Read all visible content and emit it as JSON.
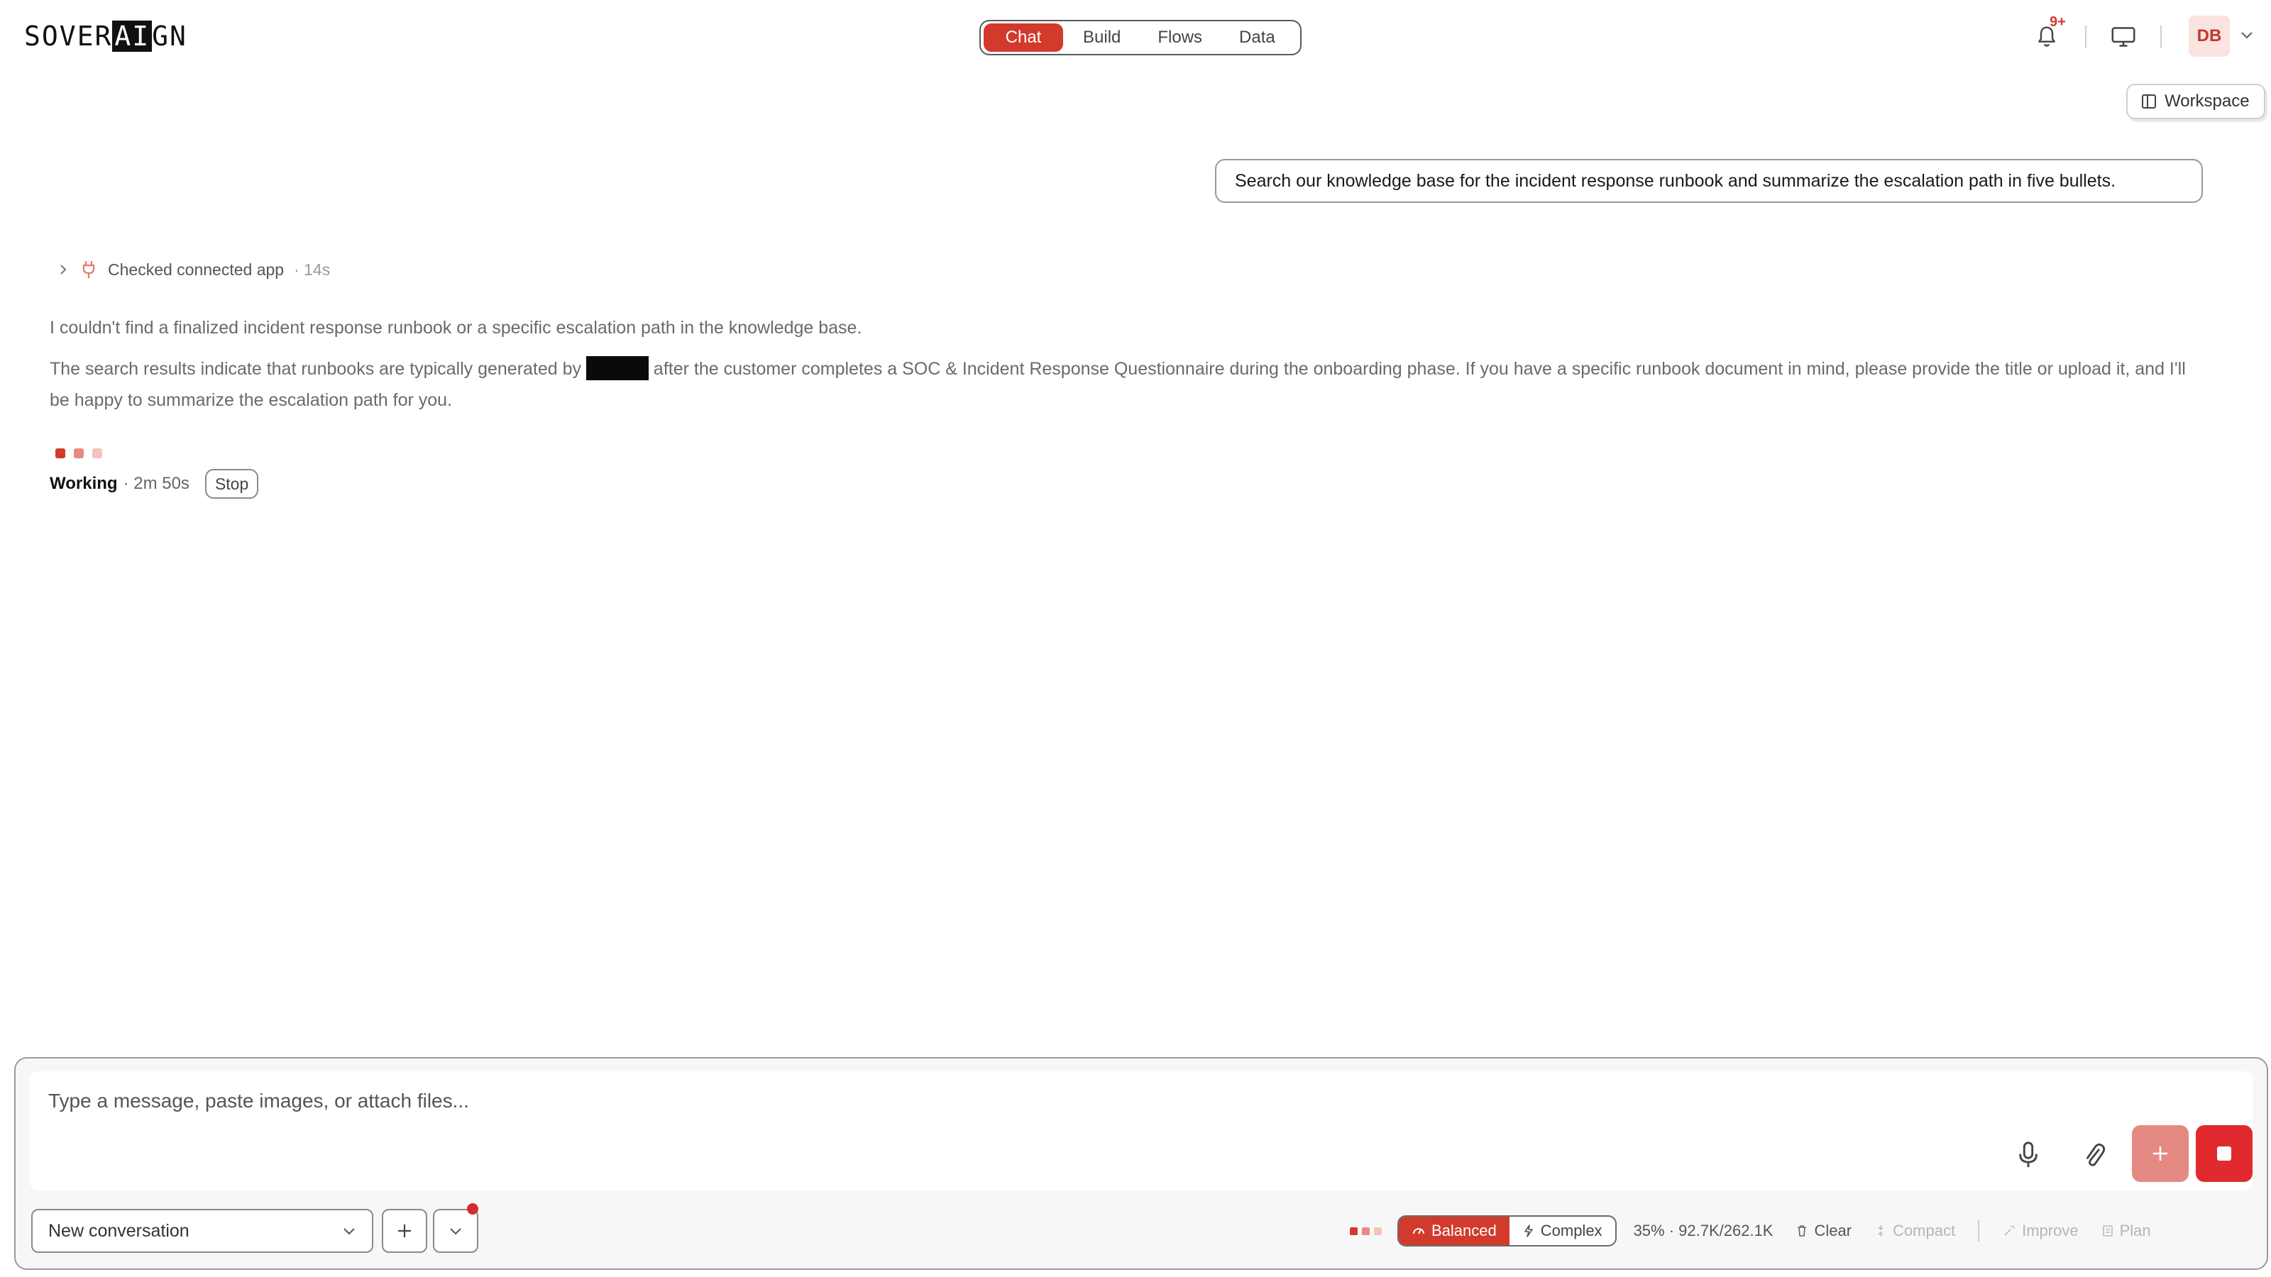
{
  "header": {
    "logo_text_pre": "SOVER",
    "logo_text_ai": "AI",
    "logo_text_post": "GN",
    "tabs": [
      {
        "label": "Chat",
        "active": true
      },
      {
        "label": "Build",
        "active": false
      },
      {
        "label": "Flows",
        "active": false
      },
      {
        "label": "Data",
        "active": false
      }
    ],
    "notifications_badge": "9+",
    "icons": [
      "bell-icon",
      "monitor-icon",
      "chevron-down-icon"
    ],
    "avatar_initials": "DB"
  },
  "workspace_button": {
    "label": "Workspace",
    "icon": "panel-icon"
  },
  "conversation": {
    "user_message": "Search our knowledge base for the incident response runbook and summarize the escalation path in five bullets.",
    "tool_call": {
      "label": "Checked connected app",
      "duration": "· 14s",
      "icon": "plug-icon"
    },
    "assistant_paragraph_1": "I couldn't find a finalized incident response runbook or a specific escalation path in the knowledge base.",
    "assistant_paragraph_2_before": "The search results indicate that runbooks are typically generated by ",
    "assistant_paragraph_2_after": " after the customer completes a SOC & Incident Response Questionnaire during the onboarding phase. If you have a specific runbook document in mind, please provide the title or upload it, and I'll be happy to summarize the escalation path for you.",
    "status": {
      "label": "Working",
      "elapsed": "· 2m 50s",
      "stop_label": "Stop"
    }
  },
  "composer": {
    "placeholder": "Type a message, paste images, or attach files...",
    "value": "",
    "conversation_select": "New conversation",
    "modes": [
      {
        "label": "Balanced",
        "active": true,
        "icon": "gauge-icon"
      },
      {
        "label": "Complex",
        "active": false,
        "icon": "bolt-icon"
      }
    ],
    "usage": "35% · 92.7K/262.1K",
    "actions": [
      {
        "label": "Clear",
        "icon": "trash-icon",
        "enabled": true
      },
      {
        "label": "Compact",
        "icon": "compress-icon",
        "enabled": false
      },
      {
        "label": "Improve",
        "icon": "wand-icon",
        "enabled": false
      },
      {
        "label": "Plan",
        "icon": "plan-icon",
        "enabled": false
      }
    ]
  },
  "colors": {
    "accent": "#d23a2c",
    "stop_red": "#e02a2f",
    "plus_pink": "#e58a82",
    "dot_1": "#d23a2c",
    "dot_2": "#e88a82",
    "dot_3": "#f4c4bf"
  }
}
